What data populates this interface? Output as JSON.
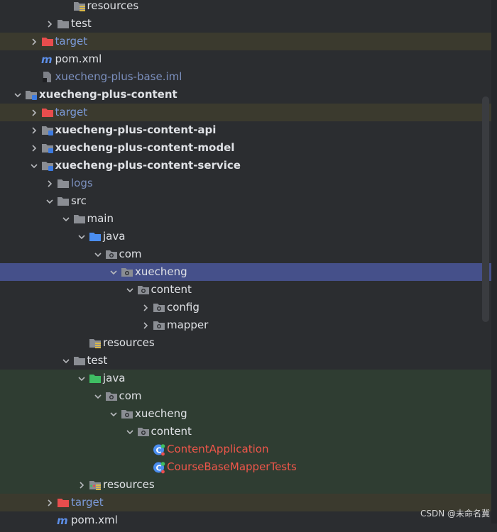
{
  "tree": {
    "rows": [
      {
        "label": "resources",
        "depth": 5,
        "icon": "resources-folder-icon",
        "chevron": "none",
        "style": "normal"
      },
      {
        "label": "test",
        "depth": 4,
        "icon": "folder-icon",
        "chevron": "right",
        "style": "normal"
      },
      {
        "label": "target",
        "depth": 3,
        "icon": "excluded-folder-icon",
        "chevron": "right",
        "style": "excluded"
      },
      {
        "label": "pom.xml",
        "depth": 3,
        "icon": "maven-icon",
        "chevron": "none",
        "style": "pom"
      },
      {
        "label": "xuecheng-plus-base.iml",
        "depth": 3,
        "icon": "iml-file-icon",
        "chevron": "none",
        "style": "iml"
      },
      {
        "label": "xuecheng-plus-content",
        "depth": 2,
        "icon": "module-folder-icon",
        "chevron": "down",
        "style": "bold"
      },
      {
        "label": "target",
        "depth": 3,
        "icon": "excluded-folder-icon",
        "chevron": "right",
        "style": "excluded"
      },
      {
        "label": "xuecheng-plus-content-api",
        "depth": 3,
        "icon": "module-folder-icon",
        "chevron": "right",
        "style": "bold"
      },
      {
        "label": "xuecheng-plus-content-model",
        "depth": 3,
        "icon": "module-folder-icon",
        "chevron": "right",
        "style": "bold"
      },
      {
        "label": "xuecheng-plus-content-service",
        "depth": 3,
        "icon": "module-folder-icon",
        "chevron": "down",
        "style": "bold"
      },
      {
        "label": "logs",
        "depth": 4,
        "icon": "folder-icon",
        "chevron": "right",
        "style": "log"
      },
      {
        "label": "src",
        "depth": 4,
        "icon": "folder-icon",
        "chevron": "down",
        "style": "normal"
      },
      {
        "label": "main",
        "depth": 5,
        "icon": "folder-icon",
        "chevron": "down",
        "style": "normal"
      },
      {
        "label": "java",
        "depth": 6,
        "icon": "source-folder-icon",
        "chevron": "down",
        "style": "normal"
      },
      {
        "label": "com",
        "depth": 7,
        "icon": "package-icon",
        "chevron": "down",
        "style": "normal"
      },
      {
        "label": "xuecheng",
        "depth": 8,
        "icon": "package-icon",
        "chevron": "down",
        "style": "selected"
      },
      {
        "label": "content",
        "depth": 9,
        "icon": "package-icon",
        "chevron": "down",
        "style": "normal"
      },
      {
        "label": "config",
        "depth": 10,
        "icon": "package-icon",
        "chevron": "right",
        "style": "normal"
      },
      {
        "label": "mapper",
        "depth": 10,
        "icon": "package-icon",
        "chevron": "right",
        "style": "normal"
      },
      {
        "label": "resources",
        "depth": 6,
        "icon": "resources-folder-icon",
        "chevron": "none",
        "style": "normal"
      },
      {
        "label": "test",
        "depth": 5,
        "icon": "folder-icon",
        "chevron": "down",
        "style": "normal"
      },
      {
        "label": "java",
        "depth": 6,
        "icon": "test-source-folder-icon",
        "chevron": "down",
        "style": "testroot"
      },
      {
        "label": "com",
        "depth": 7,
        "icon": "package-icon",
        "chevron": "down",
        "style": "testroot"
      },
      {
        "label": "xuecheng",
        "depth": 8,
        "icon": "package-icon",
        "chevron": "down",
        "style": "testroot"
      },
      {
        "label": "content",
        "depth": 9,
        "icon": "package-icon",
        "chevron": "down",
        "style": "testroot"
      },
      {
        "label": "ContentApplication",
        "depth": 10,
        "icon": "test-class-icon",
        "chevron": "none",
        "style": "testclass"
      },
      {
        "label": "CourseBaseMapperTests",
        "depth": 10,
        "icon": "test-class-icon",
        "chevron": "none",
        "style": "testclass"
      },
      {
        "label": "resources",
        "depth": 6,
        "icon": "test-resources-folder-icon",
        "chevron": "right",
        "style": "testroot"
      },
      {
        "label": "target",
        "depth": 4,
        "icon": "excluded-folder-icon",
        "chevron": "right",
        "style": "excluded"
      },
      {
        "label": "pom.xml",
        "depth": 4,
        "icon": "maven-icon",
        "chevron": "none",
        "style": "pom"
      }
    ]
  },
  "watermark": "CSDN @未命名冀",
  "colors": {
    "background": "#2b2d30",
    "excluded_row": "#3b3a2e",
    "selected_row": "#45508a",
    "test_row": "#2f3d32",
    "folder": "#8a8d93",
    "excluded_folder": "#e84d4d",
    "source_folder": "#4b8ef0",
    "test_source_folder": "#3fbf63",
    "test_class": "#f0564a",
    "maven": "#5d8fe8"
  }
}
